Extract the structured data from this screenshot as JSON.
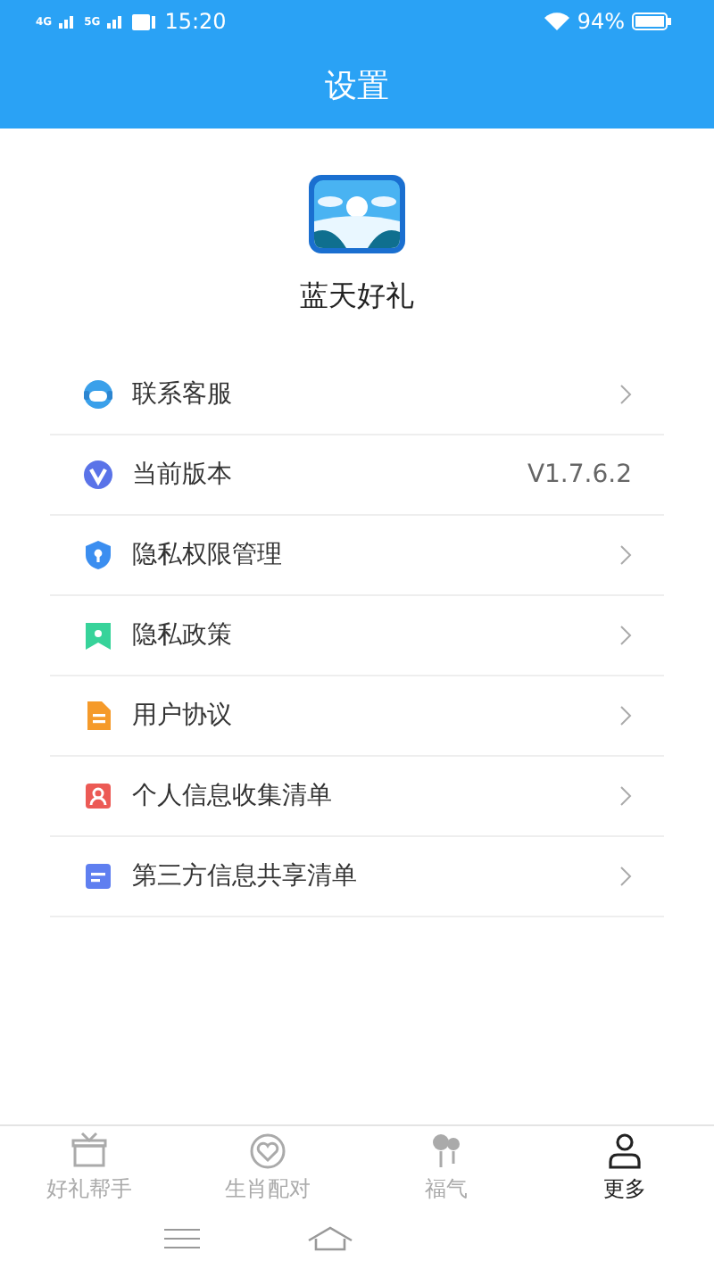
{
  "status_bar": {
    "time": "15:20",
    "battery": "94%",
    "network_1": "4G",
    "network_2": "5G"
  },
  "header": {
    "title": "设置"
  },
  "app": {
    "name": "蓝天好礼"
  },
  "menu": [
    {
      "label": "联系客服",
      "kind": "link"
    },
    {
      "label": "当前版本",
      "kind": "value",
      "value": "V1.7.6.2"
    },
    {
      "label": "隐私权限管理",
      "kind": "link"
    },
    {
      "label": "隐私政策",
      "kind": "link"
    },
    {
      "label": "用户协议",
      "kind": "link"
    },
    {
      "label": "个人信息收集清单",
      "kind": "link"
    },
    {
      "label": "第三方信息共享清单",
      "kind": "link"
    }
  ],
  "tab_bar": [
    {
      "label": "好礼帮手",
      "selected": false
    },
    {
      "label": "生肖配对",
      "selected": false
    },
    {
      "label": "福气",
      "selected": false
    },
    {
      "label": "更多",
      "selected": true
    }
  ]
}
